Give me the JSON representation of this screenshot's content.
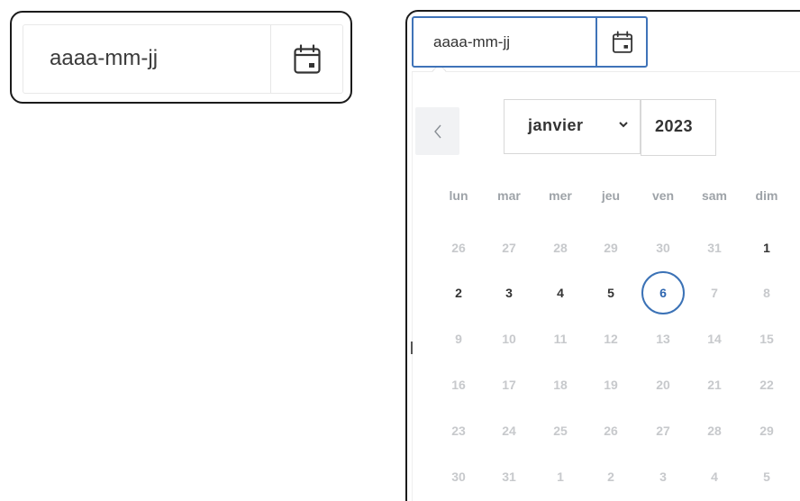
{
  "left_field": {
    "placeholder": "aaaa-mm-jj",
    "icon": "calendar-icon"
  },
  "right_field": {
    "placeholder": "aaaa-mm-jj",
    "icon": "calendar-icon"
  },
  "calendar": {
    "prev_icon": "chevron-left-icon",
    "month": "janvier",
    "year": "2023",
    "weekdays": [
      "lun",
      "mar",
      "mer",
      "jeu",
      "ven",
      "sam",
      "dim"
    ],
    "weeks": [
      [
        {
          "d": "26",
          "s": "outside"
        },
        {
          "d": "27",
          "s": "outside"
        },
        {
          "d": "28",
          "s": "outside"
        },
        {
          "d": "29",
          "s": "outside"
        },
        {
          "d": "30",
          "s": "outside"
        },
        {
          "d": "31",
          "s": "outside"
        },
        {
          "d": "1",
          "s": "inside"
        }
      ],
      [
        {
          "d": "2",
          "s": "inside"
        },
        {
          "d": "3",
          "s": "inside"
        },
        {
          "d": "4",
          "s": "inside"
        },
        {
          "d": "5",
          "s": "inside"
        },
        {
          "d": "6",
          "s": "selected"
        },
        {
          "d": "7",
          "s": "outside"
        },
        {
          "d": "8",
          "s": "outside"
        }
      ],
      [
        {
          "d": "9",
          "s": "outside"
        },
        {
          "d": "10",
          "s": "outside"
        },
        {
          "d": "11",
          "s": "outside"
        },
        {
          "d": "12",
          "s": "outside"
        },
        {
          "d": "13",
          "s": "outside"
        },
        {
          "d": "14",
          "s": "outside"
        },
        {
          "d": "15",
          "s": "outside"
        }
      ],
      [
        {
          "d": "16",
          "s": "outside"
        },
        {
          "d": "17",
          "s": "outside"
        },
        {
          "d": "18",
          "s": "outside"
        },
        {
          "d": "19",
          "s": "outside"
        },
        {
          "d": "20",
          "s": "outside"
        },
        {
          "d": "21",
          "s": "outside"
        },
        {
          "d": "22",
          "s": "outside"
        }
      ],
      [
        {
          "d": "23",
          "s": "outside"
        },
        {
          "d": "24",
          "s": "outside"
        },
        {
          "d": "25",
          "s": "outside"
        },
        {
          "d": "26",
          "s": "outside"
        },
        {
          "d": "27",
          "s": "outside"
        },
        {
          "d": "28",
          "s": "outside"
        },
        {
          "d": "29",
          "s": "outside"
        }
      ],
      [
        {
          "d": "30",
          "s": "outside"
        },
        {
          "d": "31",
          "s": "outside"
        },
        {
          "d": "1",
          "s": "outside"
        },
        {
          "d": "2",
          "s": "outside"
        },
        {
          "d": "3",
          "s": "outside"
        },
        {
          "d": "4",
          "s": "outside"
        },
        {
          "d": "5",
          "s": "outside"
        }
      ]
    ]
  },
  "colors": {
    "accent": "#3b72b6",
    "muted_day": "#c7c9cc",
    "weekday": "#9ea3a8",
    "frame": "#1b1b1b"
  }
}
